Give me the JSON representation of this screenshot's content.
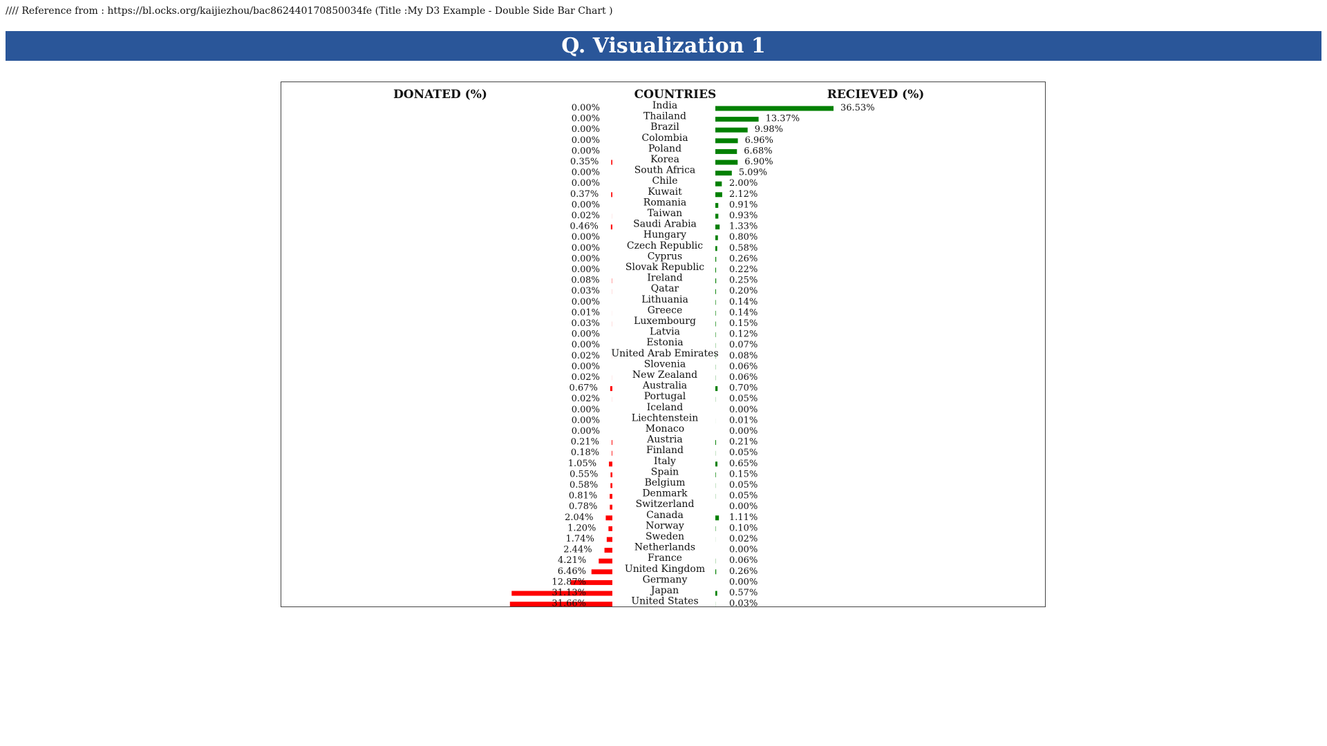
{
  "reference_note": "//// Reference from : https://bl.ocks.org/kaijiezhou/bac862440170850034fe (Title :My D3 Example - Double Side Bar Chart )",
  "banner_title": "Q. Visualization 1",
  "colors": {
    "banner": "#2a5699",
    "donated": "#ff0000",
    "received": "#008000"
  },
  "chart_data": {
    "type": "bar",
    "orientation": "horizontal-double-sided",
    "headers": {
      "left": "DONATED (%)",
      "center": "COUNTRIES",
      "right": "RECIEVED (%)"
    },
    "categories": [
      "India",
      "Thailand",
      "Brazil",
      "Colombia",
      "Poland",
      "Korea",
      "South Africa",
      "Chile",
      "Kuwait",
      "Romania",
      "Taiwan",
      "Saudi Arabia",
      "Hungary",
      "Czech Republic",
      "Cyprus",
      "Slovak Republic",
      "Ireland",
      "Qatar",
      "Lithuania",
      "Greece",
      "Luxembourg",
      "Latvia",
      "Estonia",
      "United Arab Emirates",
      "Slovenia",
      "New Zealand",
      "Australia",
      "Portugal",
      "Iceland",
      "Liechtenstein",
      "Monaco",
      "Austria",
      "Finland",
      "Italy",
      "Spain",
      "Belgium",
      "Denmark",
      "Switzerland",
      "Canada",
      "Norway",
      "Sweden",
      "Netherlands",
      "France",
      "United Kingdom",
      "Germany",
      "Japan",
      "United States"
    ],
    "series": [
      {
        "name": "DONATED (%)",
        "values": [
          0.0,
          0.0,
          0.0,
          0.0,
          0.0,
          0.35,
          0.0,
          0.0,
          0.37,
          0.0,
          0.02,
          0.46,
          0.0,
          0.0,
          0.0,
          0.0,
          0.08,
          0.03,
          0.0,
          0.01,
          0.03,
          0.0,
          0.0,
          0.02,
          0.0,
          0.02,
          0.67,
          0.02,
          0.0,
          0.0,
          0.0,
          0.21,
          0.18,
          1.05,
          0.55,
          0.58,
          0.81,
          0.78,
          2.04,
          1.2,
          1.74,
          2.44,
          4.21,
          6.46,
          12.87,
          31.13,
          31.66
        ]
      },
      {
        "name": "RECIEVED (%)",
        "values": [
          36.53,
          13.37,
          9.98,
          6.96,
          6.68,
          6.9,
          5.09,
          2.0,
          2.12,
          0.91,
          0.93,
          1.33,
          0.8,
          0.58,
          0.26,
          0.22,
          0.25,
          0.2,
          0.14,
          0.14,
          0.15,
          0.12,
          0.07,
          0.08,
          0.06,
          0.06,
          0.7,
          0.05,
          0.0,
          0.01,
          0.0,
          0.21,
          0.05,
          0.65,
          0.15,
          0.05,
          0.05,
          0.0,
          1.11,
          0.1,
          0.02,
          0.0,
          0.06,
          0.26,
          0.0,
          0.57,
          0.03
        ]
      }
    ],
    "value_format": "percent-2dp",
    "xlim": [
      0,
      36.53
    ]
  }
}
